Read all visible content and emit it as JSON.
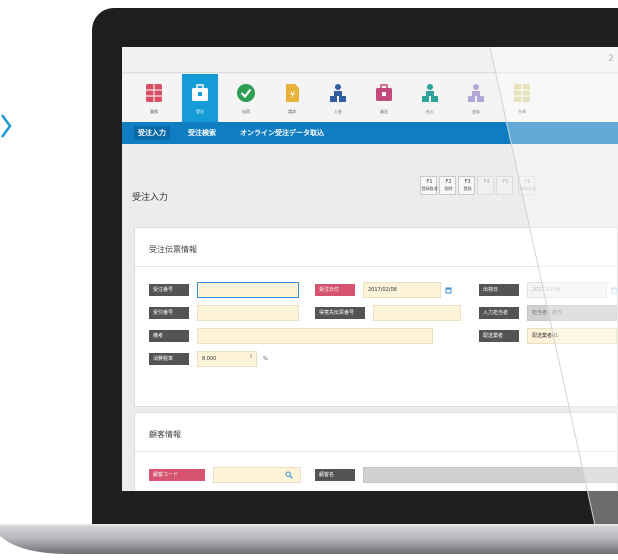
{
  "topbar": {
    "user_glyph": "2"
  },
  "iconbar": {
    "items": [
      {
        "label": "業務",
        "color": "#d94f67",
        "icon": "grid-icon",
        "active": false
      },
      {
        "label": "受注",
        "color": "#ffffff",
        "icon": "briefcase-icon",
        "active": true
      },
      {
        "label": "出荷",
        "color": "#2c9e55",
        "icon": "check-icon",
        "active": false
      },
      {
        "label": "請求",
        "color": "#e8b23a",
        "icon": "document-icon",
        "active": false
      },
      {
        "label": "入金",
        "color": "#2f5f9e",
        "icon": "people-icon",
        "active": false
      },
      {
        "label": "発注",
        "color": "#c2487e",
        "icon": "briefcase-icon",
        "active": false
      },
      {
        "label": "仕入",
        "color": "#2aa39b",
        "icon": "people-icon",
        "active": false
      },
      {
        "label": "支払",
        "color": "#b3a7d8",
        "icon": "people-icon",
        "active": false
      },
      {
        "label": "在庫",
        "color": "#d9d398",
        "icon": "grid-icon",
        "active": false
      }
    ]
  },
  "subnav": {
    "items": [
      {
        "label": "受注入力",
        "active": true
      },
      {
        "label": "受注検索",
        "active": false
      },
      {
        "label": "オンライン受注データ取込",
        "active": false
      }
    ]
  },
  "page": {
    "title": "受注入力"
  },
  "function_keys": [
    {
      "key": "F1",
      "text": "登録取消",
      "enabled": true
    },
    {
      "key": "F2",
      "text": "削除",
      "enabled": true
    },
    {
      "key": "F3",
      "text": "登録",
      "enabled": true
    },
    {
      "key": "F4",
      "text": "",
      "enabled": false
    },
    {
      "key": "F5",
      "text": "",
      "enabled": false
    },
    {
      "key": "F6",
      "text": "明細追加",
      "enabled": false
    }
  ],
  "order_section": {
    "title": "受注伝票情報",
    "fields": {
      "order_no_label": "受注番号",
      "order_date_label": "受注日付",
      "order_date_value": "2017/02/08",
      "ship_date_label": "出荷日",
      "ship_date_value": "2017/02/08",
      "slip_no_label": "受付番号",
      "customer_slip_label": "得意先伝票番号",
      "payment_label": "入力担当者",
      "payment_value": "担当者 / 担当",
      "note_label": "備考",
      "delivery_label": "配送業者",
      "delivery_value": "配送業者01",
      "tax_label": "消費税率",
      "tax_value": "8.000",
      "tax_unit": "%"
    }
  },
  "customer_section": {
    "title": "顧客情報",
    "fields": {
      "customer_code_label": "顧客コード",
      "customer_name_label": "顧客名"
    }
  }
}
